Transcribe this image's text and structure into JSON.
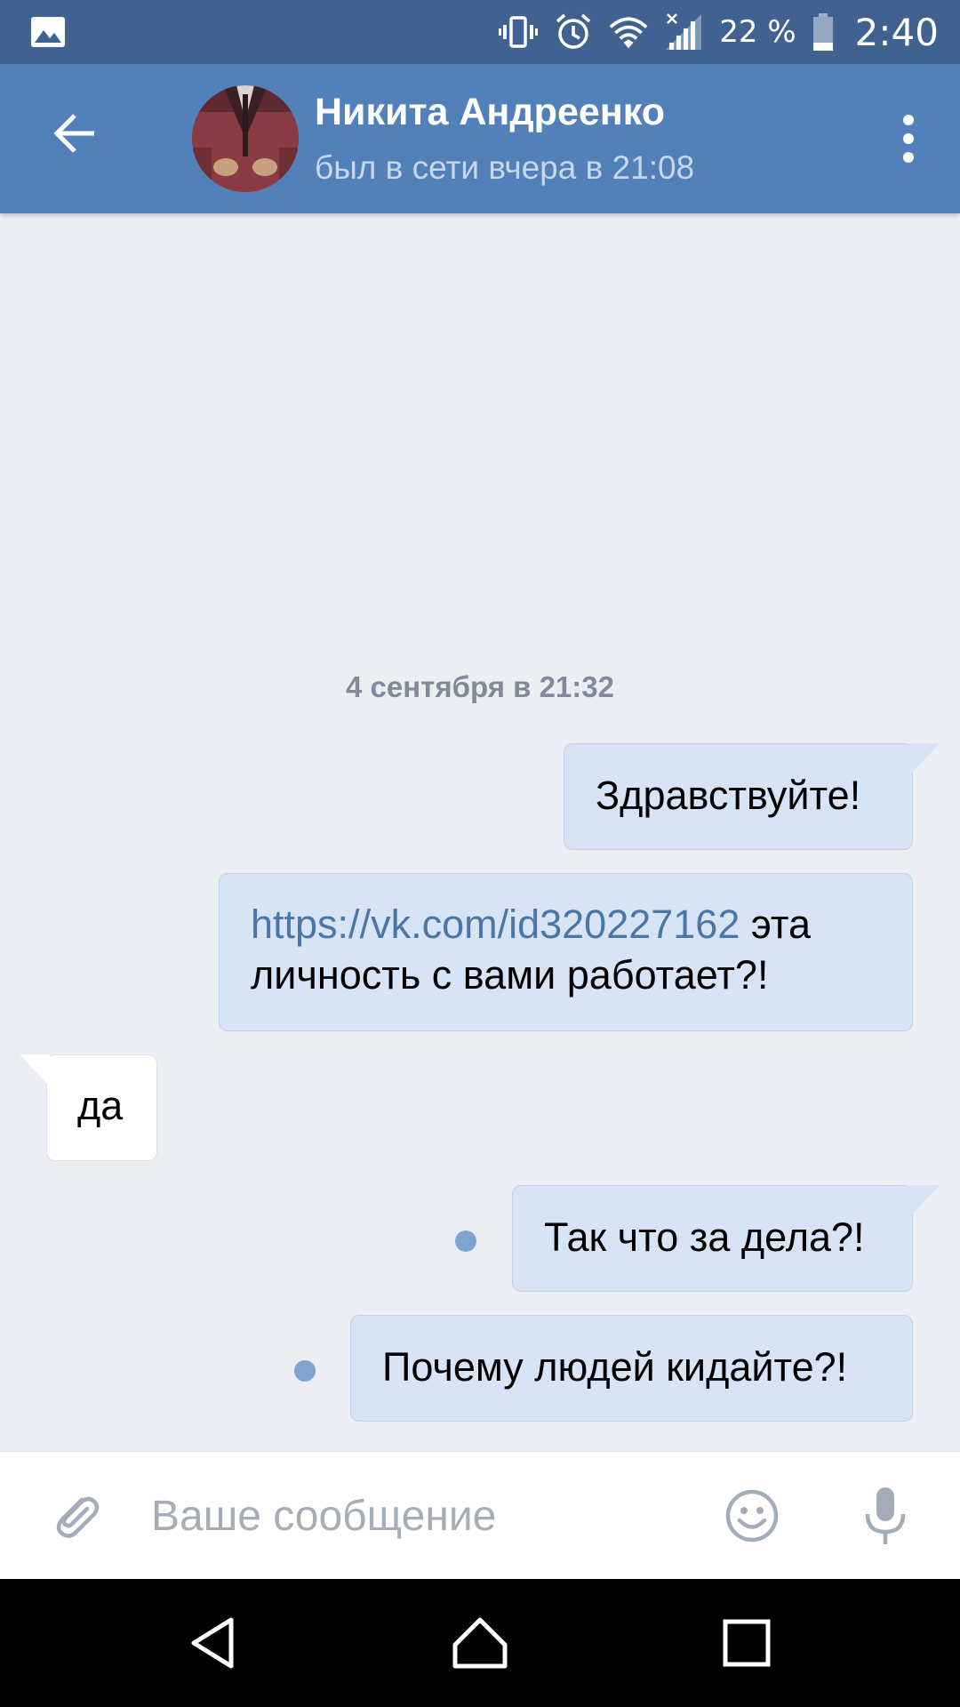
{
  "status_bar": {
    "battery_percent": "22 %",
    "time": "2:40",
    "icons": [
      "gallery-icon",
      "vibrate-icon",
      "alarm-icon",
      "wifi-icon",
      "signal-icon",
      "battery-icon"
    ]
  },
  "header": {
    "contact_name": "Никита Андреенко",
    "contact_status": "был в сети вчера в 21:08",
    "back_icon": "arrow-left-icon",
    "menu_icon": "more-vertical-icon"
  },
  "chat": {
    "date_divider": "4 сентября в 21:32",
    "messages": [
      {
        "direction": "outgoing",
        "text": "Здравствуйте!",
        "unread": false
      },
      {
        "direction": "outgoing",
        "link": "https://vk.com/id320227162",
        "line1_rest": " эта",
        "line2": "личность с вами работает?!",
        "unread": false
      },
      {
        "direction": "incoming",
        "text": "да",
        "unread": false
      },
      {
        "direction": "outgoing",
        "text": "Так что за дела?!",
        "unread": true
      },
      {
        "direction": "outgoing",
        "text": "Почему людей кидайте?!",
        "unread": true
      }
    ]
  },
  "composer": {
    "placeholder": "Ваше сообщение",
    "value": "",
    "icons": [
      "paperclip-icon",
      "emoji-icon",
      "microphone-icon"
    ]
  },
  "nav_bar": {
    "icons": [
      "back-triangle-icon",
      "home-icon",
      "recents-icon"
    ]
  },
  "colors": {
    "status_bar": "#3f6290",
    "header": "#5181b8",
    "background": "#ebeff4",
    "outgoing_bubble": "#d6e4f5",
    "incoming_bubble": "#ffffff",
    "link": "#4a76a8",
    "unread_dot": "#7fa3cf"
  }
}
